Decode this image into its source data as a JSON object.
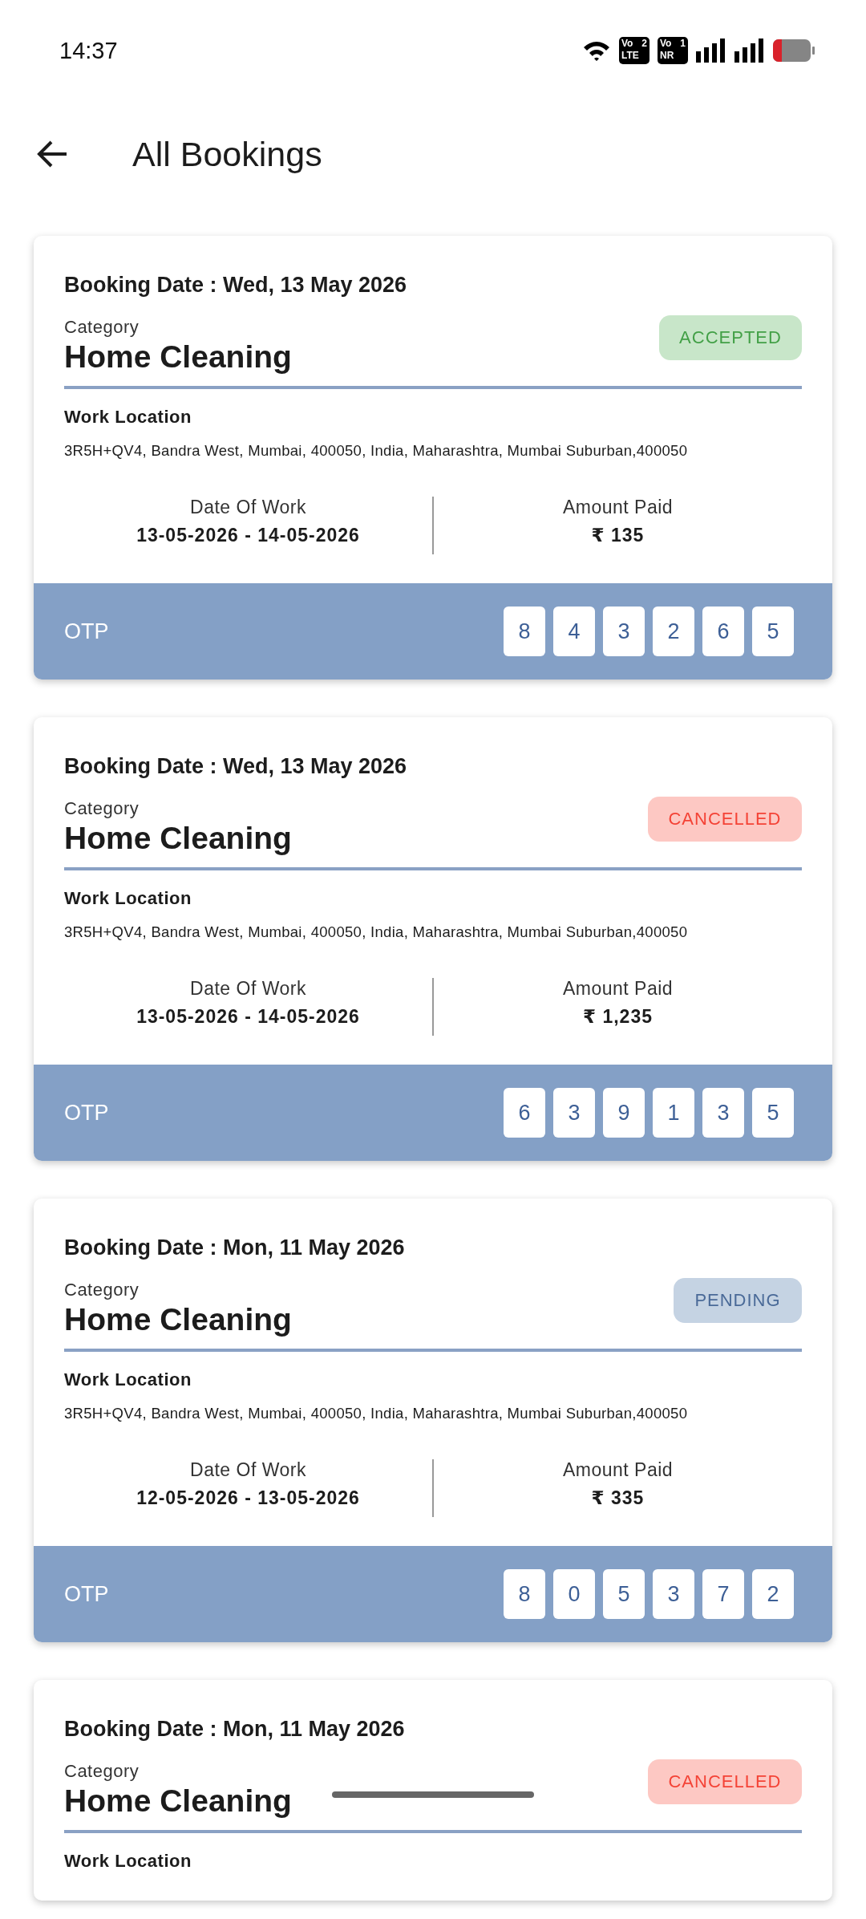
{
  "status_bar": {
    "time": "14:37",
    "sim_badges": [
      {
        "top": "Vo",
        "slot": "2",
        "bottom": "LTE"
      },
      {
        "top": "Vo",
        "slot": "1",
        "bottom": "NR"
      }
    ]
  },
  "header": {
    "title": "All Bookings"
  },
  "bookings": [
    {
      "booking_date_label": "Booking Date :",
      "booking_date": "Wed,  13 May 2026",
      "category_label": "Category",
      "category": "Home Cleaning",
      "status": {
        "label": "ACCEPTED",
        "kind": "accepted"
      },
      "location_label": "Work Location",
      "location": "3R5H+QV4, Bandra West, Mumbai, 400050, India, Maharashtra, Mumbai Suburban,400050",
      "date_of_work_label": "Date Of Work",
      "date_of_work": "13-05-2026 - 14-05-2026",
      "amount_label": "Amount Paid",
      "amount": "₹ 135",
      "otp_label": "OTP",
      "otp": [
        "8",
        "4",
        "3",
        "2",
        "6",
        "5"
      ]
    },
    {
      "booking_date_label": "Booking Date :",
      "booking_date": "Wed,  13 May 2026",
      "category_label": "Category",
      "category": "Home Cleaning",
      "status": {
        "label": "CANCELLED",
        "kind": "cancelled"
      },
      "location_label": "Work Location",
      "location": "3R5H+QV4, Bandra West, Mumbai, 400050, India, Maharashtra, Mumbai Suburban,400050",
      "date_of_work_label": "Date Of Work",
      "date_of_work": "13-05-2026 - 14-05-2026",
      "amount_label": "Amount Paid",
      "amount": "₹ 1,235",
      "otp_label": "OTP",
      "otp": [
        "6",
        "3",
        "9",
        "1",
        "3",
        "5"
      ]
    },
    {
      "booking_date_label": "Booking Date :",
      "booking_date": "Mon,  11 May 2026",
      "category_label": "Category",
      "category": "Home Cleaning",
      "status": {
        "label": "PENDING",
        "kind": "pending"
      },
      "location_label": "Work Location",
      "location": "3R5H+QV4, Bandra West, Mumbai, 400050, India, Maharashtra, Mumbai Suburban,400050",
      "date_of_work_label": "Date Of Work",
      "date_of_work": "12-05-2026 - 13-05-2026",
      "amount_label": "Amount Paid",
      "amount": "₹ 335",
      "otp_label": "OTP",
      "otp": [
        "8",
        "0",
        "5",
        "3",
        "7",
        "2"
      ]
    },
    {
      "booking_date_label": "Booking Date :",
      "booking_date": "Mon,  11 May 2026",
      "category_label": "Category",
      "category": "Home Cleaning",
      "status": {
        "label": "CANCELLED",
        "kind": "cancelled"
      },
      "location_label": "Work Location"
    }
  ]
}
